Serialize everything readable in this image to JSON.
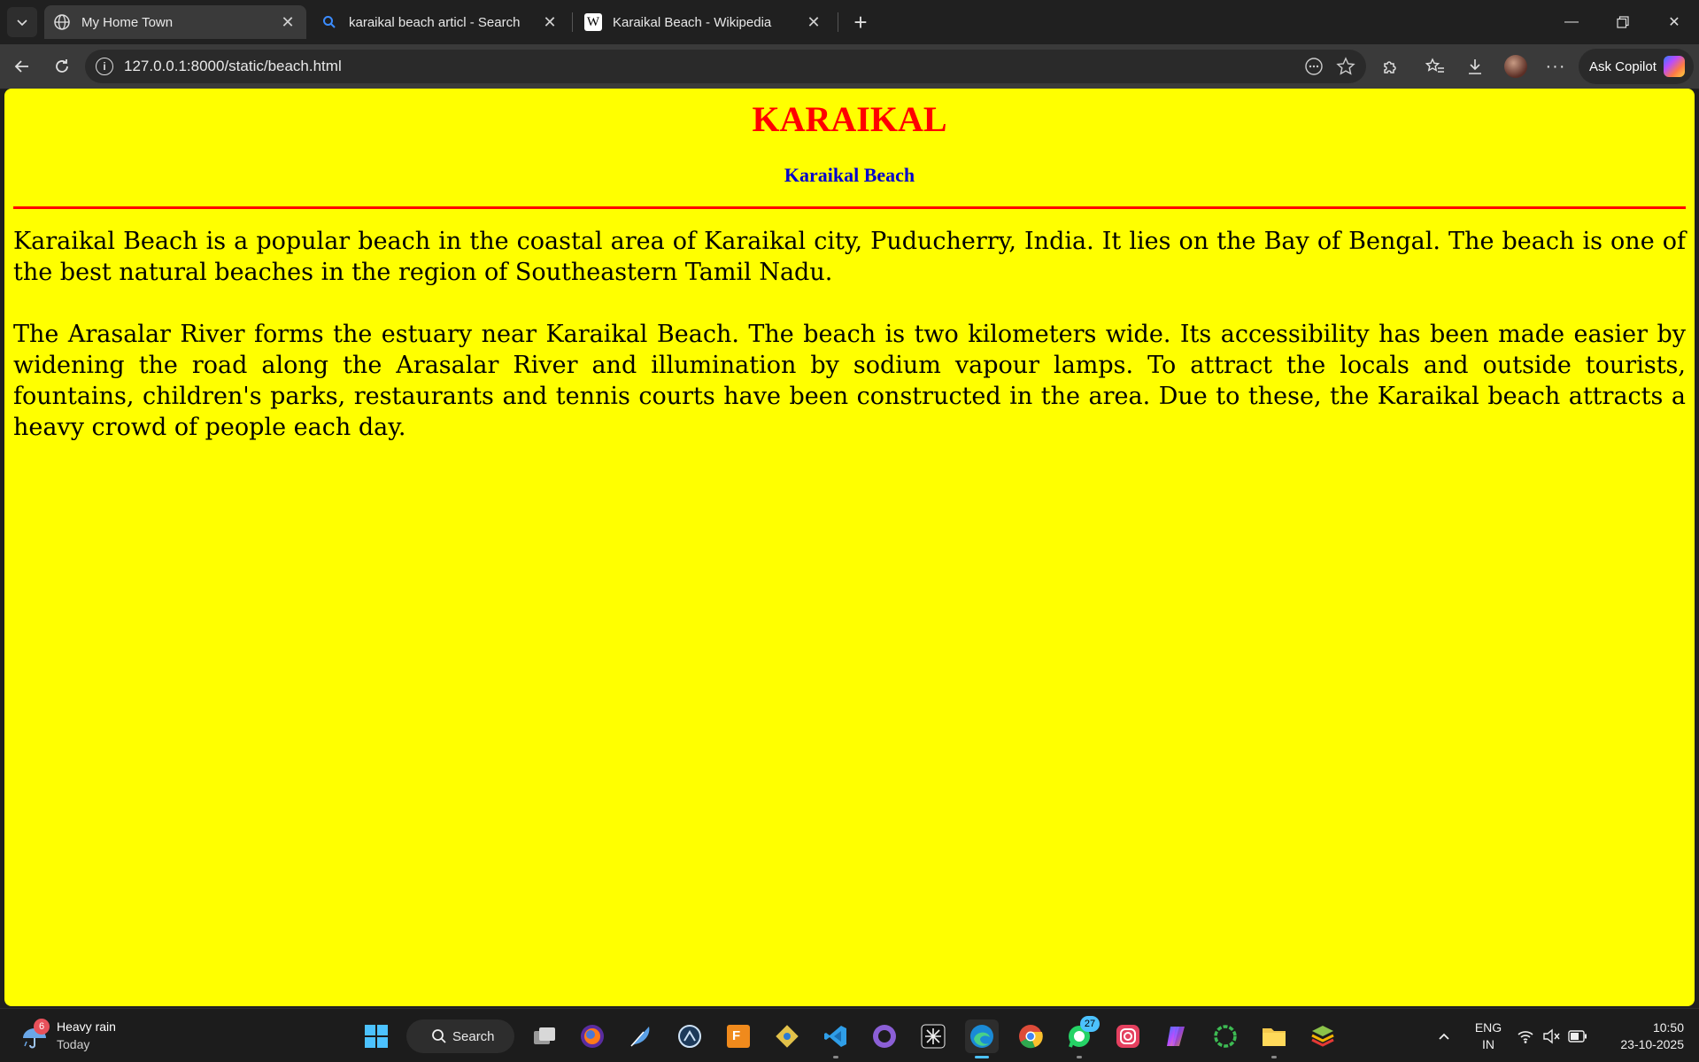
{
  "browser": {
    "tabs": [
      {
        "title": "My Home Town",
        "icon": "globe-icon",
        "active": true
      },
      {
        "title": "karaikal beach articl - Search",
        "icon": "search-icon",
        "active": false
      },
      {
        "title": "Karaikal Beach - Wikipedia",
        "icon": "wikipedia-icon",
        "active": false
      }
    ],
    "url": "127.0.0.1:8000/static/beach.html",
    "copilot_label": "Ask Copilot"
  },
  "page": {
    "heading": "KARAIKAL",
    "subheading": "Karaikal Beach",
    "paragraphs": [
      "Karaikal Beach is a popular beach in the coastal area of Karaikal city, Puducherry, India. It lies on the Bay of Bengal. The beach is one of the best natural beaches in the region of Southeastern Tamil Nadu.",
      "The Arasalar River forms the estuary near Karaikal Beach. The beach is two kilometers wide. Its accessibility has been made easier by widening the road along the Arasalar River and illumination by sodium vapour lamps. To attract the locals and outside tourists, fountains, children's parks, restaurants and tennis courts have been constructed in the area. Due to these, the Karaikal beach attracts a heavy crowd of people each day."
    ],
    "colors": {
      "background": "#ffff00",
      "heading": "#ff0000",
      "subheading": "#0000cc",
      "rule": "#ff0000"
    }
  },
  "taskbar": {
    "weather": {
      "title": "Heavy rain",
      "subtitle": "Today",
      "badge": "6"
    },
    "search_label": "Search",
    "whatsapp_badge": "27",
    "language": {
      "line1": "ENG",
      "line2": "IN"
    },
    "clock": {
      "time": "10:50",
      "date": "23-10-2025"
    }
  }
}
